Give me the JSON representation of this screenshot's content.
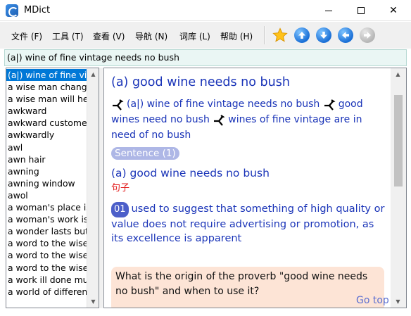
{
  "window": {
    "title": "MDict"
  },
  "menu": [
    "文件 (F)",
    "工具 (T)",
    "查看 (V)",
    "导航 (N)",
    "词库 (L)",
    "帮助 (H)"
  ],
  "search": {
    "value": "(a|) wine of fine vintage needs no bush"
  },
  "word_list": [
    "(a|) wine of fine vintage needs no bush",
    "a wise man changes his mind",
    "a wise man will hear",
    "awkward",
    "awkward customer",
    "awkwardly",
    "awl",
    "awn hair",
    "awning",
    "awning window",
    "awol",
    "a woman's place is in the home",
    "a woman's work is never done",
    "a wonder lasts but nine days",
    "a word to the wise",
    "a word to the wise is enough",
    "a word to the wise is sufficient",
    "a work ill done must be twice done",
    "a world of difference"
  ],
  "entry": {
    "headword": "(a) good wine needs no bush",
    "xref_1": "(a|) wine of fine vintage needs no bush",
    "xref_2": "good wines need no bush",
    "xref_3": "wines of fine vintage are in need of no bush",
    "sentence_pill": "Sentence (1)",
    "sub_headword": "(a) good wine needs no bush",
    "chinese_label": "句子",
    "sense_number": "01",
    "sense_text": "used to suggest that something of high quality or value does not require advertising or promotion, as its excellence is apparent",
    "note_text": "What is the origin of the proverb \"good wine needs no bush\" and when to use it?",
    "go_top": "Go top"
  },
  "colors": {
    "selection": "#0078d7",
    "link_blue": "#1a34b8",
    "chinese_red": "#e21b1b",
    "pill_bg": "#aeb7e6",
    "note_bg": "#fde4d6",
    "search_bg": "#eaf6f4"
  },
  "icons": [
    "app-icon",
    "minimize-icon",
    "maximize-icon",
    "close-icon",
    "favorite-star-icon",
    "arrow-up-icon",
    "arrow-down-icon",
    "arrow-left-icon",
    "arrow-right-icon",
    "crossref-arrow-icon"
  ]
}
